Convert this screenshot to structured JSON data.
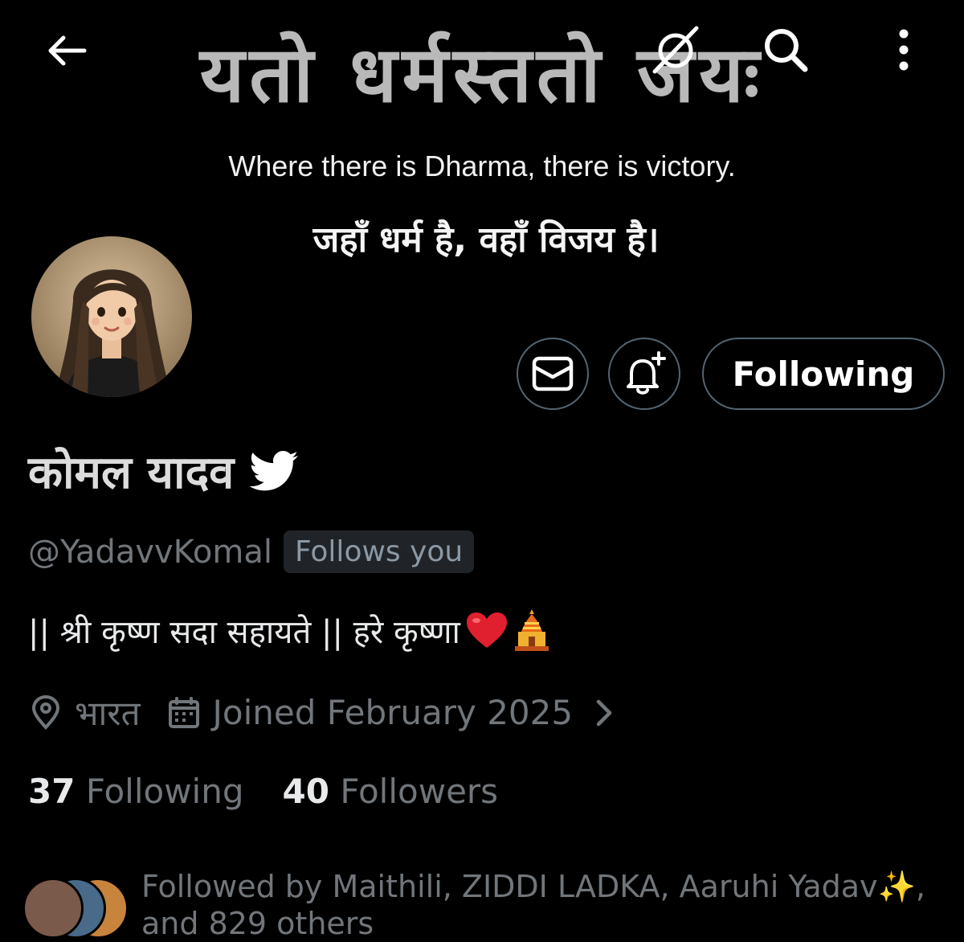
{
  "banner": {
    "sanskrit": "यतो धर्मस्ततो जयः",
    "english": "Where there is Dharma, there is victory.",
    "hindi": "जहाँ धर्म है, वहाँ विजय है।"
  },
  "profile": {
    "display_name": "कोमल यादव",
    "handle": "@YadavvKomal",
    "follows_you": "Follows you",
    "bio_text": "|| श्री कृष्ण सदा सहायते || हरे कृष्णा",
    "bio_emojis": "❤️",
    "location": "भारत",
    "joined": "Joined February 2025",
    "following_count": "37",
    "following_label": "Following",
    "followers_count": "40",
    "followers_label": "Followers",
    "followed_by_line1": "Followed by Maithili, ZIDDI LADKA, Aaruhi Yadav✨,",
    "followed_by_line2": "and 829 others"
  },
  "actions": {
    "following_button": "Following"
  },
  "icons": {
    "back": "arrow-left-icon",
    "grok": "grok-icon",
    "search": "search-icon",
    "more": "more-vertical-icon",
    "message": "envelope-icon",
    "notification": "bell-plus-icon",
    "verified": "bird-icon",
    "location": "location-pin-icon",
    "calendar": "calendar-icon",
    "chevron": "chevron-right-icon"
  },
  "colors": {
    "background": "#000000",
    "primary_text": "#e7e9ea",
    "secondary_text": "#71767b",
    "border": "#536471",
    "badge_bg": "#202327"
  }
}
